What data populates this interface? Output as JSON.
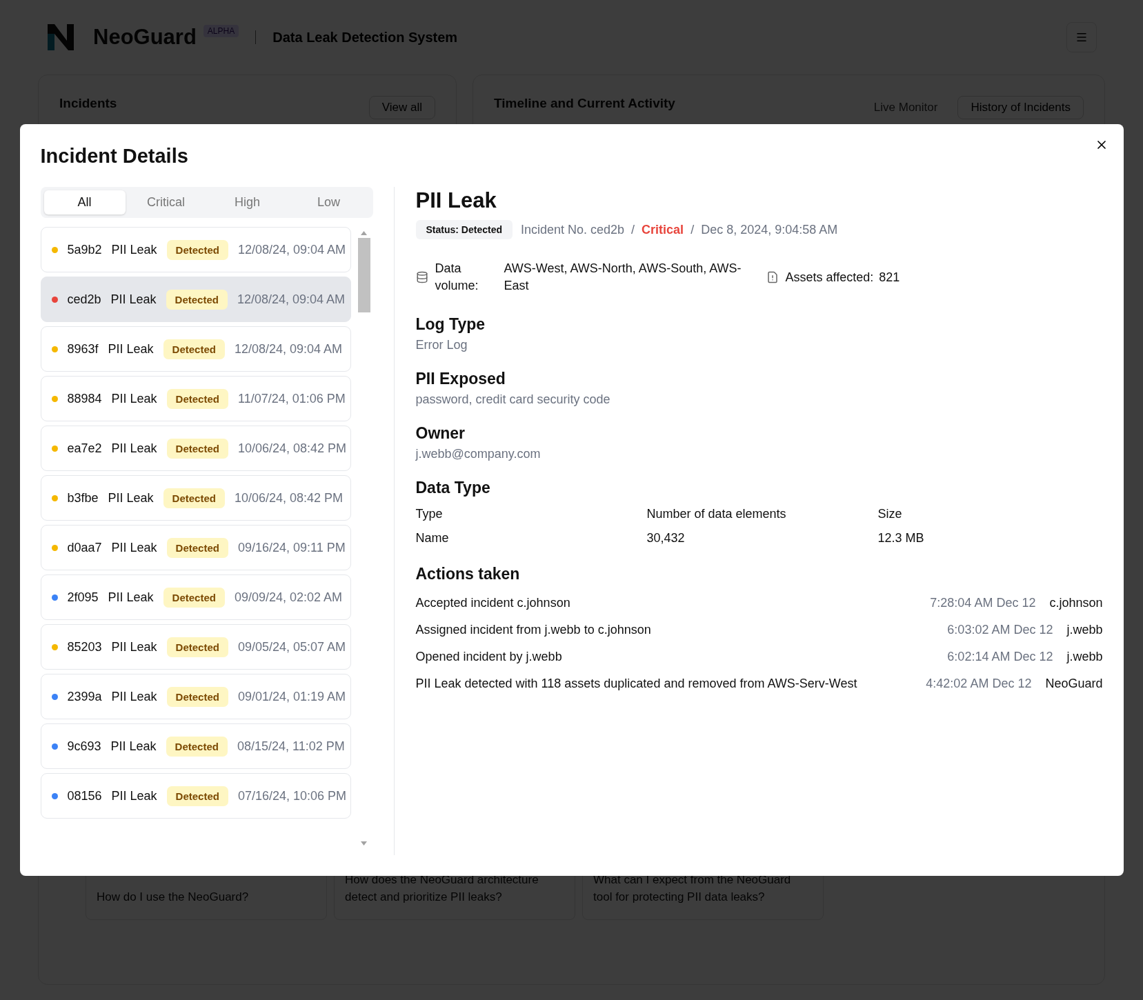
{
  "header": {
    "brand": "NeoGuard",
    "badge": "ALPHA",
    "subtitle": "Data Leak Detection System"
  },
  "dashboard": {
    "incidents_card": {
      "title": "Incidents",
      "button": "View all"
    },
    "timeline_card": {
      "title": "Timeline and Current Activity",
      "tabs": [
        {
          "label": "Live Monitor",
          "selected": false
        },
        {
          "label": "History of Incidents",
          "selected": true
        }
      ]
    },
    "questions": [
      "How do I use the NeoGuard?",
      "How does the NeoGuard architecture detect and prioritize PII leaks?",
      "What can I expect from the NeoGuard tool for protecting PII data leaks?"
    ]
  },
  "modal": {
    "title": "Incident Details",
    "filter_tabs": [
      {
        "label": "All",
        "selected": true
      },
      {
        "label": "Critical",
        "selected": false
      },
      {
        "label": "High",
        "selected": false
      },
      {
        "label": "Low",
        "selected": false
      }
    ],
    "incidents": [
      {
        "id": "5a9b2",
        "type": "PII Leak",
        "status": "Detected",
        "time": "12/08/24, 09:04 AM",
        "color": "#f5b800",
        "selected": false
      },
      {
        "id": "ced2b",
        "type": "PII Leak",
        "status": "Detected",
        "time": "12/08/24, 09:04 AM",
        "color": "#e8453c",
        "selected": true
      },
      {
        "id": "8963f",
        "type": "PII Leak",
        "status": "Detected",
        "time": "12/08/24, 09:04 AM",
        "color": "#f5b800",
        "selected": false
      },
      {
        "id": "88984",
        "type": "PII Leak",
        "status": "Detected",
        "time": "11/07/24, 01:06 PM",
        "color": "#f5b800",
        "selected": false
      },
      {
        "id": "ea7e2",
        "type": "PII Leak",
        "status": "Detected",
        "time": "10/06/24, 08:42 PM",
        "color": "#f5b800",
        "selected": false
      },
      {
        "id": "b3fbe",
        "type": "PII Leak",
        "status": "Detected",
        "time": "10/06/24, 08:42 PM",
        "color": "#f5b800",
        "selected": false
      },
      {
        "id": "d0aa7",
        "type": "PII Leak",
        "status": "Detected",
        "time": "09/16/24, 09:11 PM",
        "color": "#f5b800",
        "selected": false
      },
      {
        "id": "2f095",
        "type": "PII Leak",
        "status": "Detected",
        "time": "09/09/24, 02:02 AM",
        "color": "#3b82f6",
        "selected": false
      },
      {
        "id": "85203",
        "type": "PII Leak",
        "status": "Detected",
        "time": "09/05/24, 05:07 AM",
        "color": "#f5b800",
        "selected": false
      },
      {
        "id": "2399a",
        "type": "PII Leak",
        "status": "Detected",
        "time": "09/01/24, 01:19 AM",
        "color": "#3b82f6",
        "selected": false
      },
      {
        "id": "9c693",
        "type": "PII Leak",
        "status": "Detected",
        "time": "08/15/24, 11:02 PM",
        "color": "#3b82f6",
        "selected": false
      },
      {
        "id": "08156",
        "type": "PII Leak",
        "status": "Detected",
        "time": "07/16/24, 10:06 PM",
        "color": "#3b82f6",
        "selected": false
      }
    ],
    "detail": {
      "title": "PII Leak",
      "status": "Status: Detected",
      "incident_no": "Incident No. ced2b",
      "severity": "Critical",
      "separator": "/",
      "date": "Dec 8, 2024, 9:04:58 AM",
      "data_volume_label": "Data volume:",
      "data_volume": "AWS-West, AWS-North, AWS-South, AWS-East",
      "assets_label": "Assets affected:",
      "assets": "821",
      "sections": [
        {
          "heading": "Log Type",
          "text": "Error Log"
        },
        {
          "heading": "PII Exposed",
          "text": "password, credit card security code"
        },
        {
          "heading": "Owner",
          "text": "j.webb@company.com"
        }
      ],
      "data_type": {
        "heading": "Data Type",
        "columns": [
          "Type",
          "Number of data elements",
          "Size"
        ],
        "rows": [
          [
            "Name",
            "30,432",
            "12.3 MB"
          ]
        ]
      },
      "actions": {
        "heading": "Actions taken",
        "items": [
          {
            "text": "Accepted incident c.johnson",
            "time": "7:28:04 AM Dec 12",
            "user": "c.johnson"
          },
          {
            "text": "Assigned incident from j.webb to c.johnson",
            "time": "6:03:02 AM Dec 12",
            "user": "j.webb"
          },
          {
            "text": "Opened incident by j.webb",
            "time": "6:02:14 AM Dec 12",
            "user": "j.webb"
          },
          {
            "text": "PII Leak detected with 118 assets duplicated and removed from AWS-Serv-West",
            "time": "4:42:02 AM Dec 12",
            "user": "NeoGuard"
          }
        ]
      }
    }
  }
}
